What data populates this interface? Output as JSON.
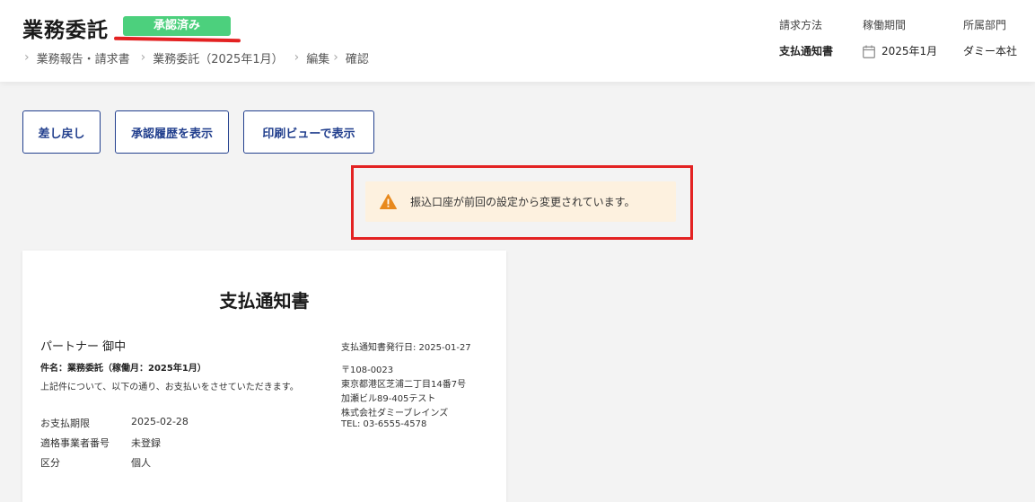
{
  "header": {
    "title": "業務委託",
    "status_badge": "承認済み",
    "breadcrumb": [
      "業務報告・請求書",
      "業務委託（2025年1月）",
      "編集",
      "確認"
    ],
    "meta": {
      "billing_method": {
        "label": "請求方法",
        "value": "支払通知書"
      },
      "work_period": {
        "label": "稼働期間",
        "value": "2025年1月",
        "icon": "calendar-icon"
      },
      "department": {
        "label": "所属部門",
        "value": "ダミー本社"
      }
    }
  },
  "actions": {
    "send_back": "差し戻し",
    "show_history": "承認履歴を表示",
    "print_view": "印刷ビューで表示"
  },
  "alert": {
    "icon": "warning-icon",
    "message": "振込口座が前回の設定から変更されています。",
    "highlight_color": "#e32222"
  },
  "document": {
    "title": "支払通知書",
    "recipient": "パートナー 御中",
    "subject": "件名：業務委託（稼働月：2025年1月）",
    "intro": "上記件について、以下の通り、お支払いをさせていただきます。",
    "fields": [
      {
        "label": "お支払期限",
        "value": "2025-02-28"
      },
      {
        "label": "適格事業者番号",
        "value": "未登録"
      },
      {
        "label": "区分",
        "value": "個人"
      }
    ],
    "issue_date": "支払通知書発行日: 2025-01-27",
    "issuer": {
      "postal": "〒108-0023",
      "address1": "東京都港区芝浦二丁目14番7号",
      "address2": "加瀬ビル89-405テスト",
      "company": "株式会社ダミーブレインズ",
      "tel": "TEL: 03-6555-4578"
    }
  },
  "colors": {
    "badge": "#4cd07d",
    "button_text": "#23408e",
    "alert_bg": "#fdf1df",
    "warning": "#e8891d"
  }
}
